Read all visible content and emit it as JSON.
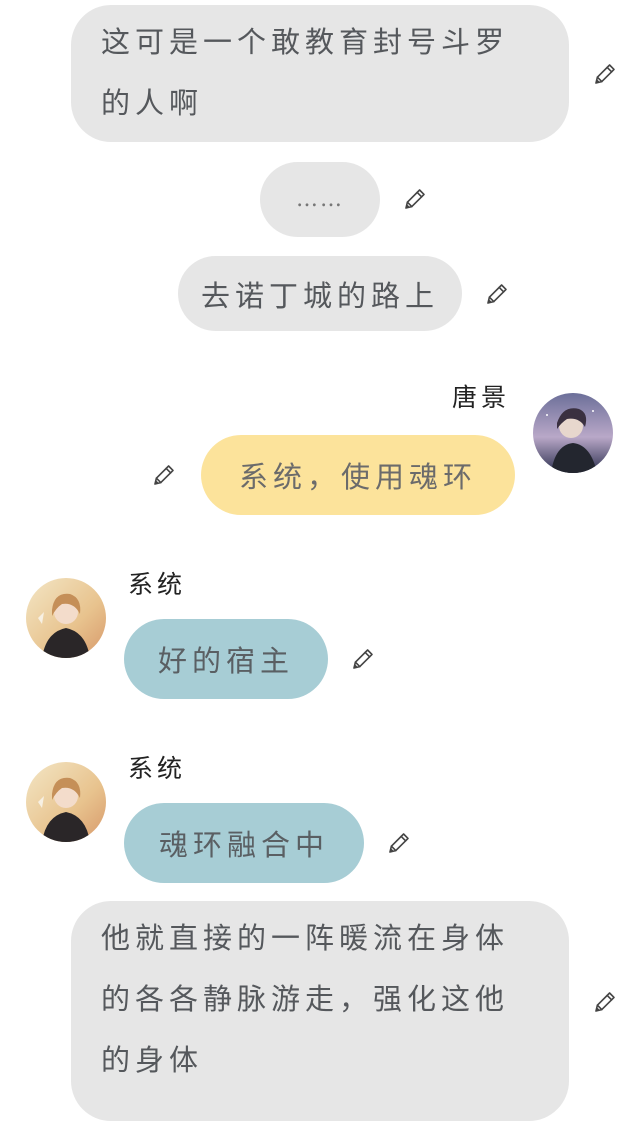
{
  "messages": [
    {
      "type": "narration",
      "text": "这可是一个敢教育封号斗罗的人啊"
    },
    {
      "type": "narration",
      "text": "……"
    },
    {
      "type": "narration",
      "text": "去诺丁城的路上"
    },
    {
      "type": "user",
      "sender": "唐景",
      "text": "系统，使用魂环"
    },
    {
      "type": "system",
      "sender": "系统",
      "text": "好的宿主"
    },
    {
      "type": "system",
      "sender": "系统",
      "text": "魂环融合中"
    },
    {
      "type": "narration",
      "text": "他就直接的一阵暖流在身体的各各静脉游走，强化这他的身体"
    }
  ],
  "icons": {
    "edit": "pencil-icon",
    "avatar_user": "anime-avatar-dark",
    "avatar_system": "anime-avatar-warm"
  },
  "colors": {
    "narration_bubble": "#e6e6e6",
    "user_bubble": "#fce39b",
    "system_bubble": "#a7cdd5",
    "text": "#55585c",
    "background": "#ffffff"
  }
}
